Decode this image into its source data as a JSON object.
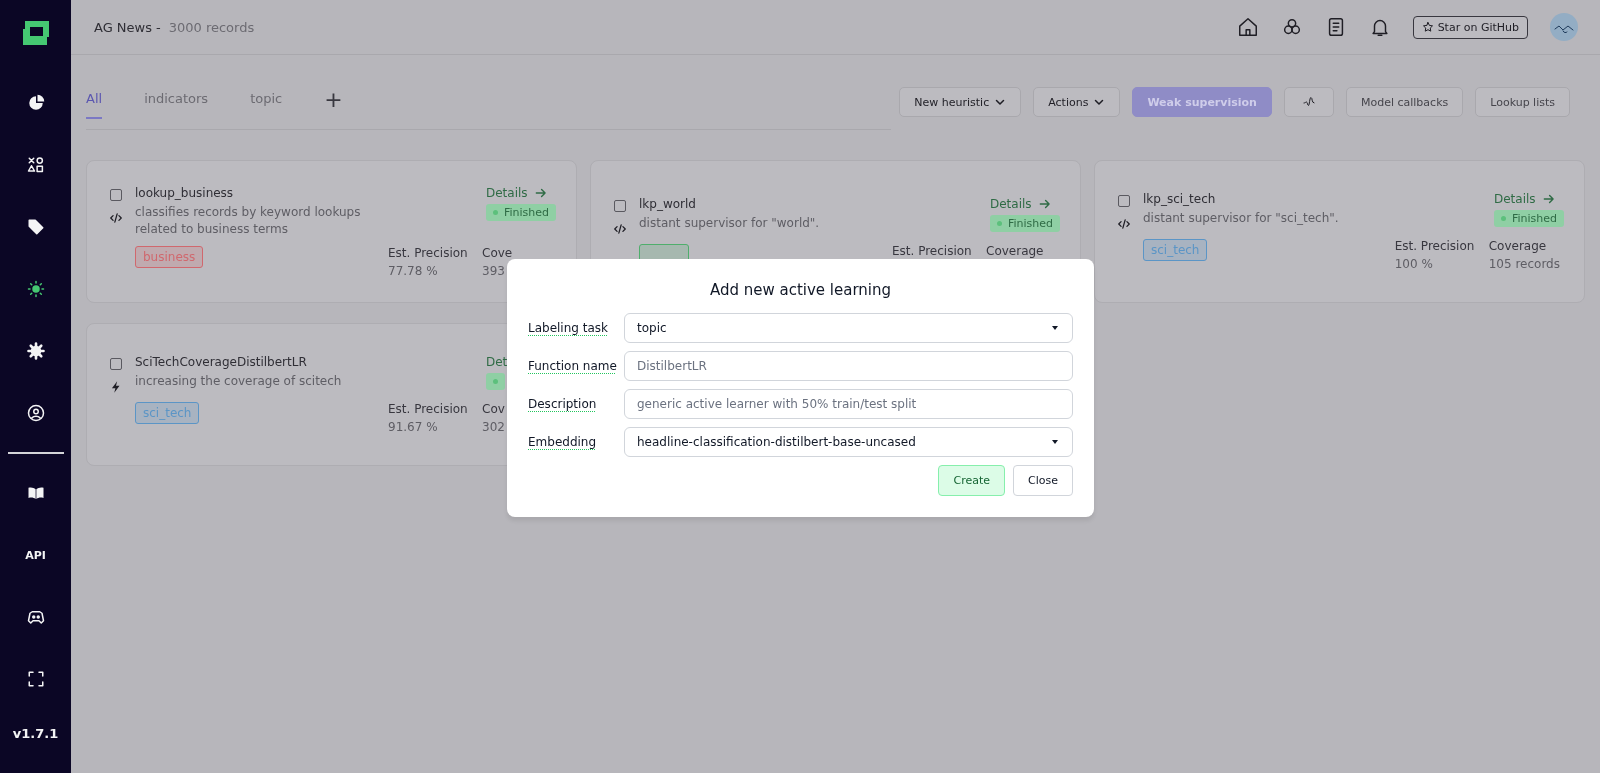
{
  "sidebar": {
    "items": [
      {
        "kind": "icon",
        "selected": false
      },
      {
        "kind": "icon",
        "selected": false
      },
      {
        "kind": "icon",
        "selected": false
      },
      {
        "kind": "icon",
        "selected": true
      },
      {
        "kind": "icon",
        "selected": false
      },
      {
        "kind": "icon",
        "selected": false
      },
      {
        "kind": "icon",
        "selected": false
      },
      {
        "kind": "text",
        "label": "API",
        "selected": false
      },
      {
        "kind": "icon",
        "selected": false
      },
      {
        "kind": "icon",
        "selected": false
      }
    ],
    "version": "v1.7.1"
  },
  "header": {
    "project": "AG News",
    "separator": "-",
    "records": "3000 records",
    "github_button": "Star on GitHub"
  },
  "tabs": [
    {
      "label": "All",
      "selected": true
    },
    {
      "label": "indicators",
      "selected": false
    },
    {
      "label": "topic",
      "selected": false
    }
  ],
  "add_tab": "+",
  "toolbar": [
    {
      "label": "New heuristic",
      "kind": "dropdown"
    },
    {
      "label": "Actions",
      "kind": "dropdown"
    },
    {
      "label": "Weak supervision",
      "kind": "primary"
    },
    {
      "kind": "icon"
    },
    {
      "label": "Model callbacks",
      "kind": "plain"
    },
    {
      "label": "Lookup lists",
      "kind": "plain"
    }
  ],
  "cards": [
    {
      "name": "lookup_business",
      "kind": "code",
      "checked": false,
      "description": "classifies records by keyword lookups related to business terms",
      "details": "Details",
      "status": "Finished",
      "tag": {
        "label": "business",
        "color": "#d0686e"
      },
      "precision_label": "Est. Precision",
      "precision": "77.78 %",
      "coverage_label": "Cove",
      "coverage": "393"
    },
    {
      "name": "lkp_world",
      "kind": "code",
      "checked": false,
      "description": "distant supervisor for \"world\".",
      "details": "Details",
      "status": "Finished",
      "tag": {
        "color": "#4fae6c"
      },
      "precision_label": "Est. Precision",
      "coverage_label": "Coverage"
    },
    {
      "name": "lkp_sci_tech",
      "kind": "code",
      "checked": false,
      "description": "distant supervisor for \"sci_tech\".",
      "details": "Details",
      "status": "Finished",
      "tag": {
        "label": "sci_tech",
        "color": "#5b95c6"
      },
      "precision_label": "Est. Precision",
      "precision": "100 %",
      "coverage_label": "Coverage",
      "coverage": "105 records"
    },
    {
      "name": "SciTechCoverageDistilbertLR",
      "kind": "active_learning",
      "checked": false,
      "description": "increasing the coverage of scitech",
      "details": "Det",
      "tag": {
        "label": "sci_tech",
        "color": "#5b95c6"
      },
      "precision_label": "Est. Precision",
      "precision": "91.67 %",
      "coverage_label": "Cov",
      "coverage": "302"
    }
  ],
  "modal": {
    "title": "Add new active learning",
    "fields": [
      {
        "label": "Labeling task",
        "kind": "select",
        "value": "topic"
      },
      {
        "label": "Function name",
        "kind": "input",
        "value": "DistilbertLR"
      },
      {
        "label": "Description",
        "kind": "input",
        "value": "generic active learner with 50% train/test split"
      },
      {
        "label": "Embedding",
        "kind": "select",
        "value": "headline-classification-distilbert-base-uncased"
      }
    ],
    "buttons": [
      {
        "label": "Create",
        "kind": "primary"
      },
      {
        "label": "Close",
        "kind": "plain"
      }
    ]
  }
}
